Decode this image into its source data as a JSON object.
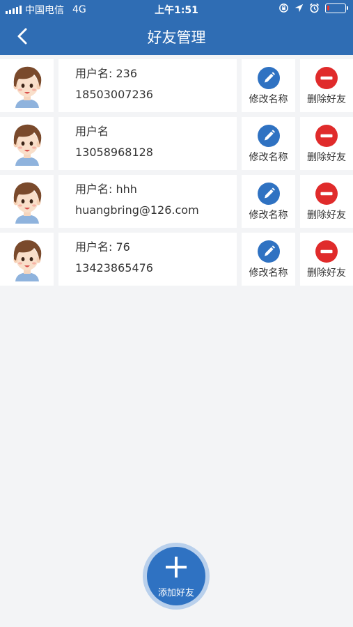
{
  "status_bar": {
    "carrier": "中国电信",
    "network": "4G",
    "time": "上午1:51",
    "battery_color": "#e8342c"
  },
  "nav": {
    "title": "好友管理",
    "back_icon": "chevron-left-icon"
  },
  "actions": {
    "edit_label": "修改名称",
    "edit_icon": "pencil-icon",
    "edit_color": "#2f72c2",
    "delete_label": "删除好友",
    "delete_icon": "minus-circle-icon",
    "delete_color": "#e02b2b"
  },
  "friends": [
    {
      "name": "用户名: 236",
      "contact": "18503007236"
    },
    {
      "name": "用户名",
      "contact": "13058968128"
    },
    {
      "name": "用户名: hhh",
      "contact": "huangbring@126.com"
    },
    {
      "name": "用户名: 76",
      "contact": "13423865476"
    }
  ],
  "fab": {
    "label": "添加好友",
    "icon": "plus-icon"
  },
  "colors": {
    "primary": "#2f6db4",
    "background": "#f3f4f6"
  }
}
